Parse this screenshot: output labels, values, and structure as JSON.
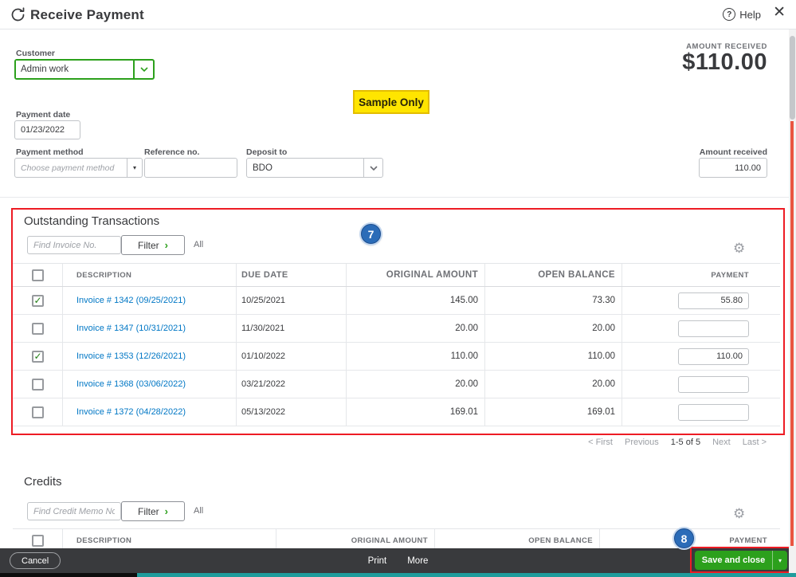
{
  "colors": {
    "accent_green": "#2ca01c",
    "link_blue": "#0077c5",
    "annotation_red": "#ed1c24",
    "annotation_blue": "#2b6cb8",
    "highlight_yellow": "#ffe500",
    "footer_dark": "#393a3d"
  },
  "icons": {
    "help": "?",
    "close": "✕",
    "gear": "⚙",
    "check": "✓",
    "caret_down": "▾",
    "chevron_right": "›"
  },
  "header": {
    "title": "Receive Payment",
    "help_label": "Help"
  },
  "summary": {
    "amount_received_label": "AMOUNT RECEIVED",
    "amount_received_value": "$110.00"
  },
  "sample_badge": {
    "label": "Sample Only"
  },
  "form": {
    "customer_label": "Customer",
    "customer_value": "Admin work",
    "payment_date_label": "Payment date",
    "payment_date_value": "01/23/2022",
    "payment_method_label": "Payment method",
    "payment_method_placeholder": "Choose payment method",
    "reference_label": "Reference no.",
    "reference_value": "",
    "deposit_to_label": "Deposit to",
    "deposit_to_value": "BDO",
    "amount_received_label": "Amount received",
    "amount_received_value": "110.00"
  },
  "outstanding": {
    "title": "Outstanding Transactions",
    "find_placeholder": "Find Invoice No.",
    "filter_label": "Filter",
    "all_label": "All",
    "columns": {
      "description": "DESCRIPTION",
      "due_date": "DUE DATE",
      "original_amount": "ORIGINAL AMOUNT",
      "open_balance": "OPEN BALANCE",
      "payment": "PAYMENT"
    },
    "rows": [
      {
        "checked": true,
        "description": "Invoice # 1342 (09/25/2021)",
        "due_date": "10/25/2021",
        "original_amount": "145.00",
        "open_balance": "73.30",
        "payment": "55.80"
      },
      {
        "checked": false,
        "description": "Invoice # 1347 (10/31/2021)",
        "due_date": "11/30/2021",
        "original_amount": "20.00",
        "open_balance": "20.00",
        "payment": ""
      },
      {
        "checked": true,
        "description": "Invoice # 1353 (12/26/2021)",
        "due_date": "01/10/2022",
        "original_amount": "110.00",
        "open_balance": "110.00",
        "payment": "110.00"
      },
      {
        "checked": false,
        "description": "Invoice # 1368 (03/06/2022)",
        "due_date": "03/21/2022",
        "original_amount": "20.00",
        "open_balance": "20.00",
        "payment": ""
      },
      {
        "checked": false,
        "description": "Invoice # 1372 (04/28/2022)",
        "due_date": "05/13/2022",
        "original_amount": "169.01",
        "open_balance": "169.01",
        "payment": ""
      }
    ],
    "pagination": {
      "first": "< First",
      "previous": "Previous",
      "range": "1-5 of 5",
      "next": "Next",
      "last": "Last >"
    }
  },
  "credits": {
    "title": "Credits",
    "find_placeholder": "Find Credit Memo No.",
    "filter_label": "Filter",
    "all_label": "All",
    "columns": {
      "description": "DESCRIPTION",
      "original_amount": "ORIGINAL AMOUNT",
      "open_balance": "OPEN BALANCE",
      "payment": "PAYMENT"
    }
  },
  "footer": {
    "cancel_label": "Cancel",
    "print_label": "Print",
    "more_label": "More",
    "save_label": "Save and close"
  },
  "annotations": {
    "step7": "7",
    "step8": "8"
  }
}
